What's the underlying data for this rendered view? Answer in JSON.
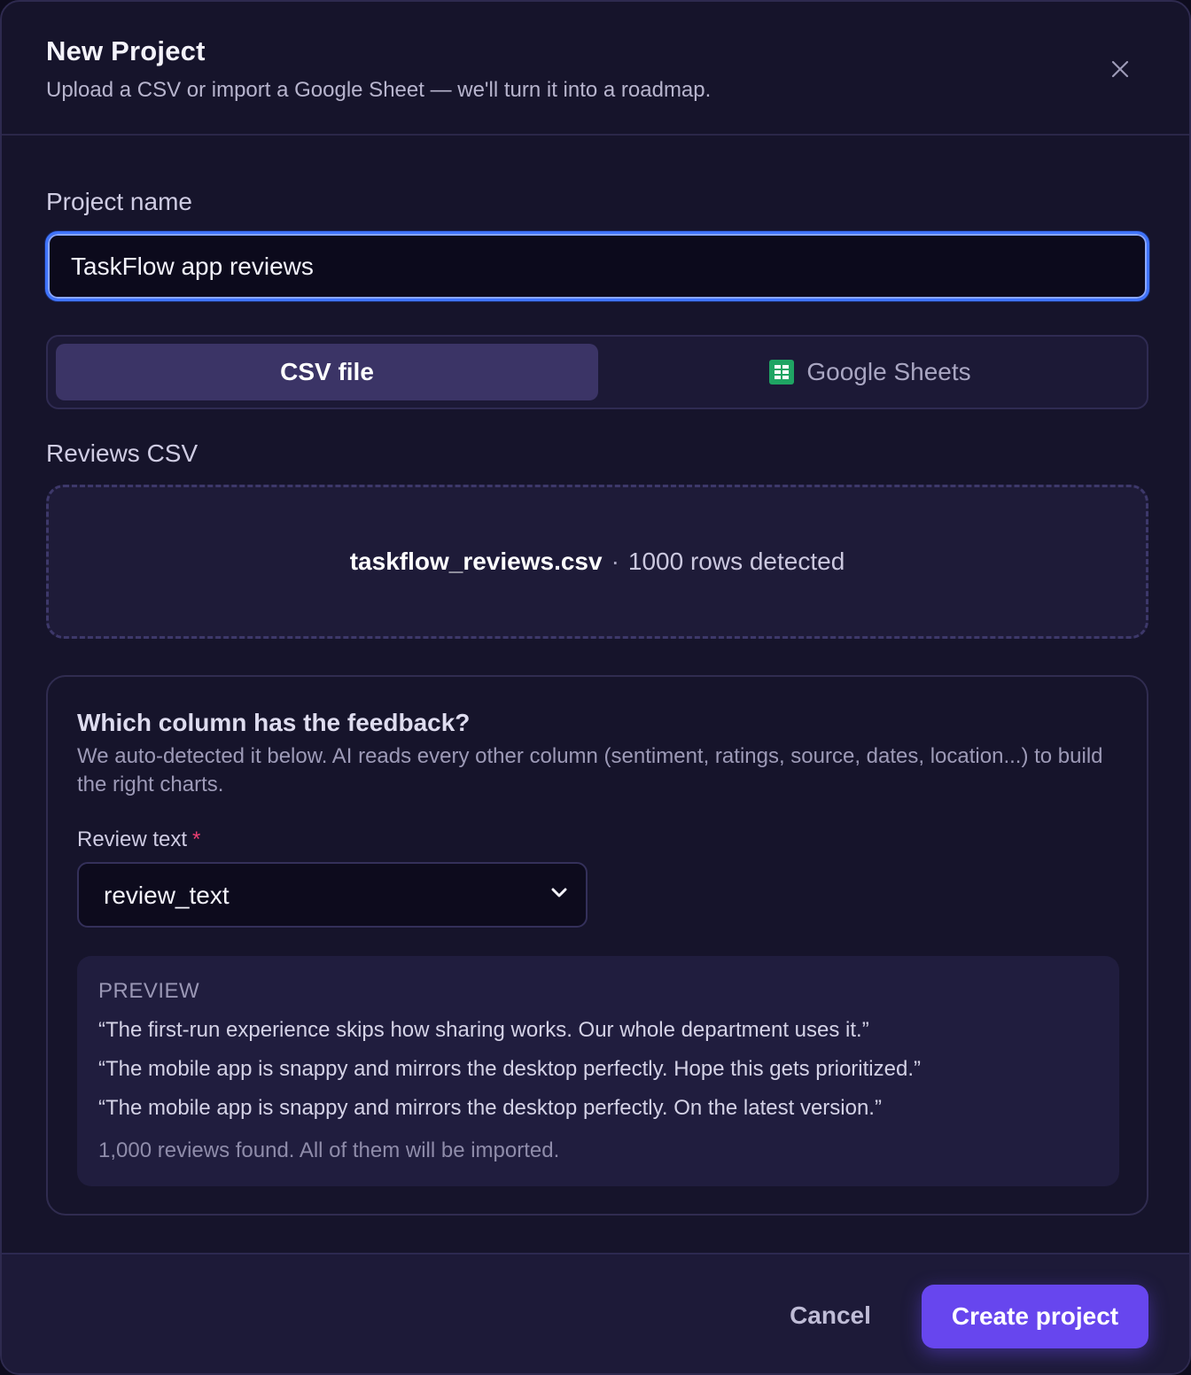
{
  "header": {
    "title": "New Project",
    "subtitle": "Upload a CSV or import a Google Sheet — we'll turn it into a roadmap.",
    "close_icon": "close-icon"
  },
  "project_name": {
    "label": "Project name",
    "value": "TaskFlow app reviews"
  },
  "source_tabs": [
    {
      "label": "CSV file",
      "selected": true
    },
    {
      "label": "Google Sheets",
      "selected": false,
      "icon": "google-sheets-icon"
    }
  ],
  "upload": {
    "label": "Reviews CSV",
    "file_name": "taskflow_reviews.csv",
    "separator": "·",
    "rows_detected": "1000 rows detected"
  },
  "column_picker": {
    "title": "Which column has the feedback?",
    "description": "We auto-detected it below. AI reads every other column (sentiment, ratings, source, dates, location...) to build the right charts.",
    "field_label": "Review text",
    "required_mark": "*",
    "selected_column": "review_text",
    "chevron_icon": "chevron-down-icon"
  },
  "preview": {
    "title": "PREVIEW",
    "lines": [
      "“The first-run experience skips how sharing works. Our whole department uses it.”",
      "“The mobile app is snappy and mirrors the desktop perfectly. Hope this gets prioritized.”",
      "“The mobile app is snappy and mirrors the desktop perfectly. On the latest version.”"
    ],
    "footer": "1,000 reviews found. All of them will be imported."
  },
  "footer": {
    "cancel_label": "Cancel",
    "create_label": "Create project"
  },
  "colors": {
    "background": "#16142b",
    "accent": "#6746ee",
    "focus_ring": "#3f74ff",
    "required": "#ec3f72",
    "sheets_green": "#1fa463"
  }
}
